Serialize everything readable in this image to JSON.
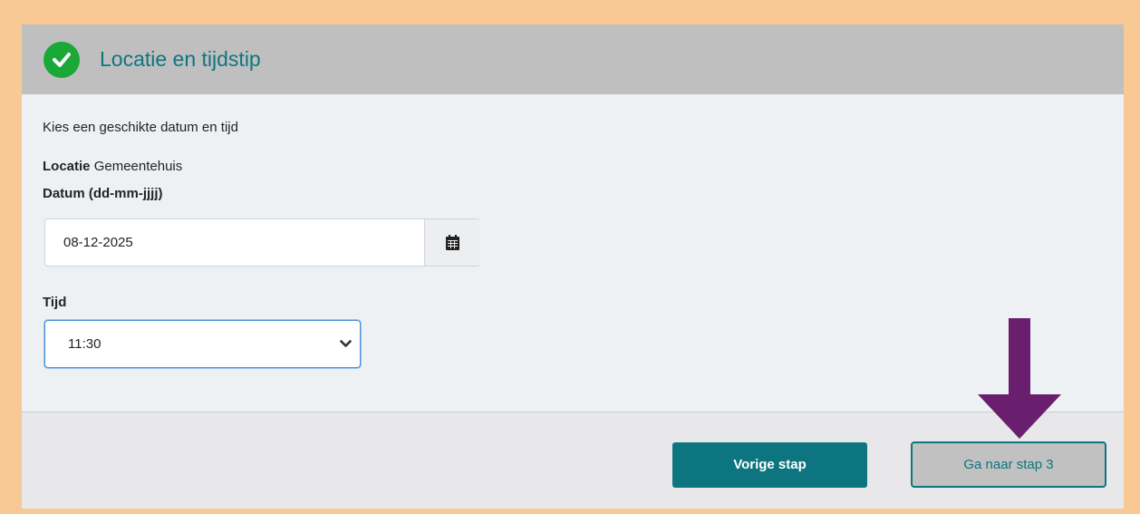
{
  "header": {
    "title": "Locatie en tijdstip",
    "status_icon": "check-circle-icon",
    "status_color": "#1aa837"
  },
  "form": {
    "intro": "Kies een geschikte datum en tijd",
    "location_label": "Locatie",
    "location_value": "Gemeentehuis",
    "date_label": "Datum (dd-mm-jjjj)",
    "date_value": "08-12-2025",
    "date_button_icon": "calendar-icon",
    "time_label": "Tijd",
    "time_value": "11:30"
  },
  "footer": {
    "prev_label": "Vorige stap",
    "next_label": "Ga naar stap 3"
  },
  "annotation": {
    "arrow_icon": "arrow-down-icon",
    "arrow_color": "#6a1f6e"
  },
  "colors": {
    "accent": "#0c7580",
    "frame": "#f8c895"
  }
}
